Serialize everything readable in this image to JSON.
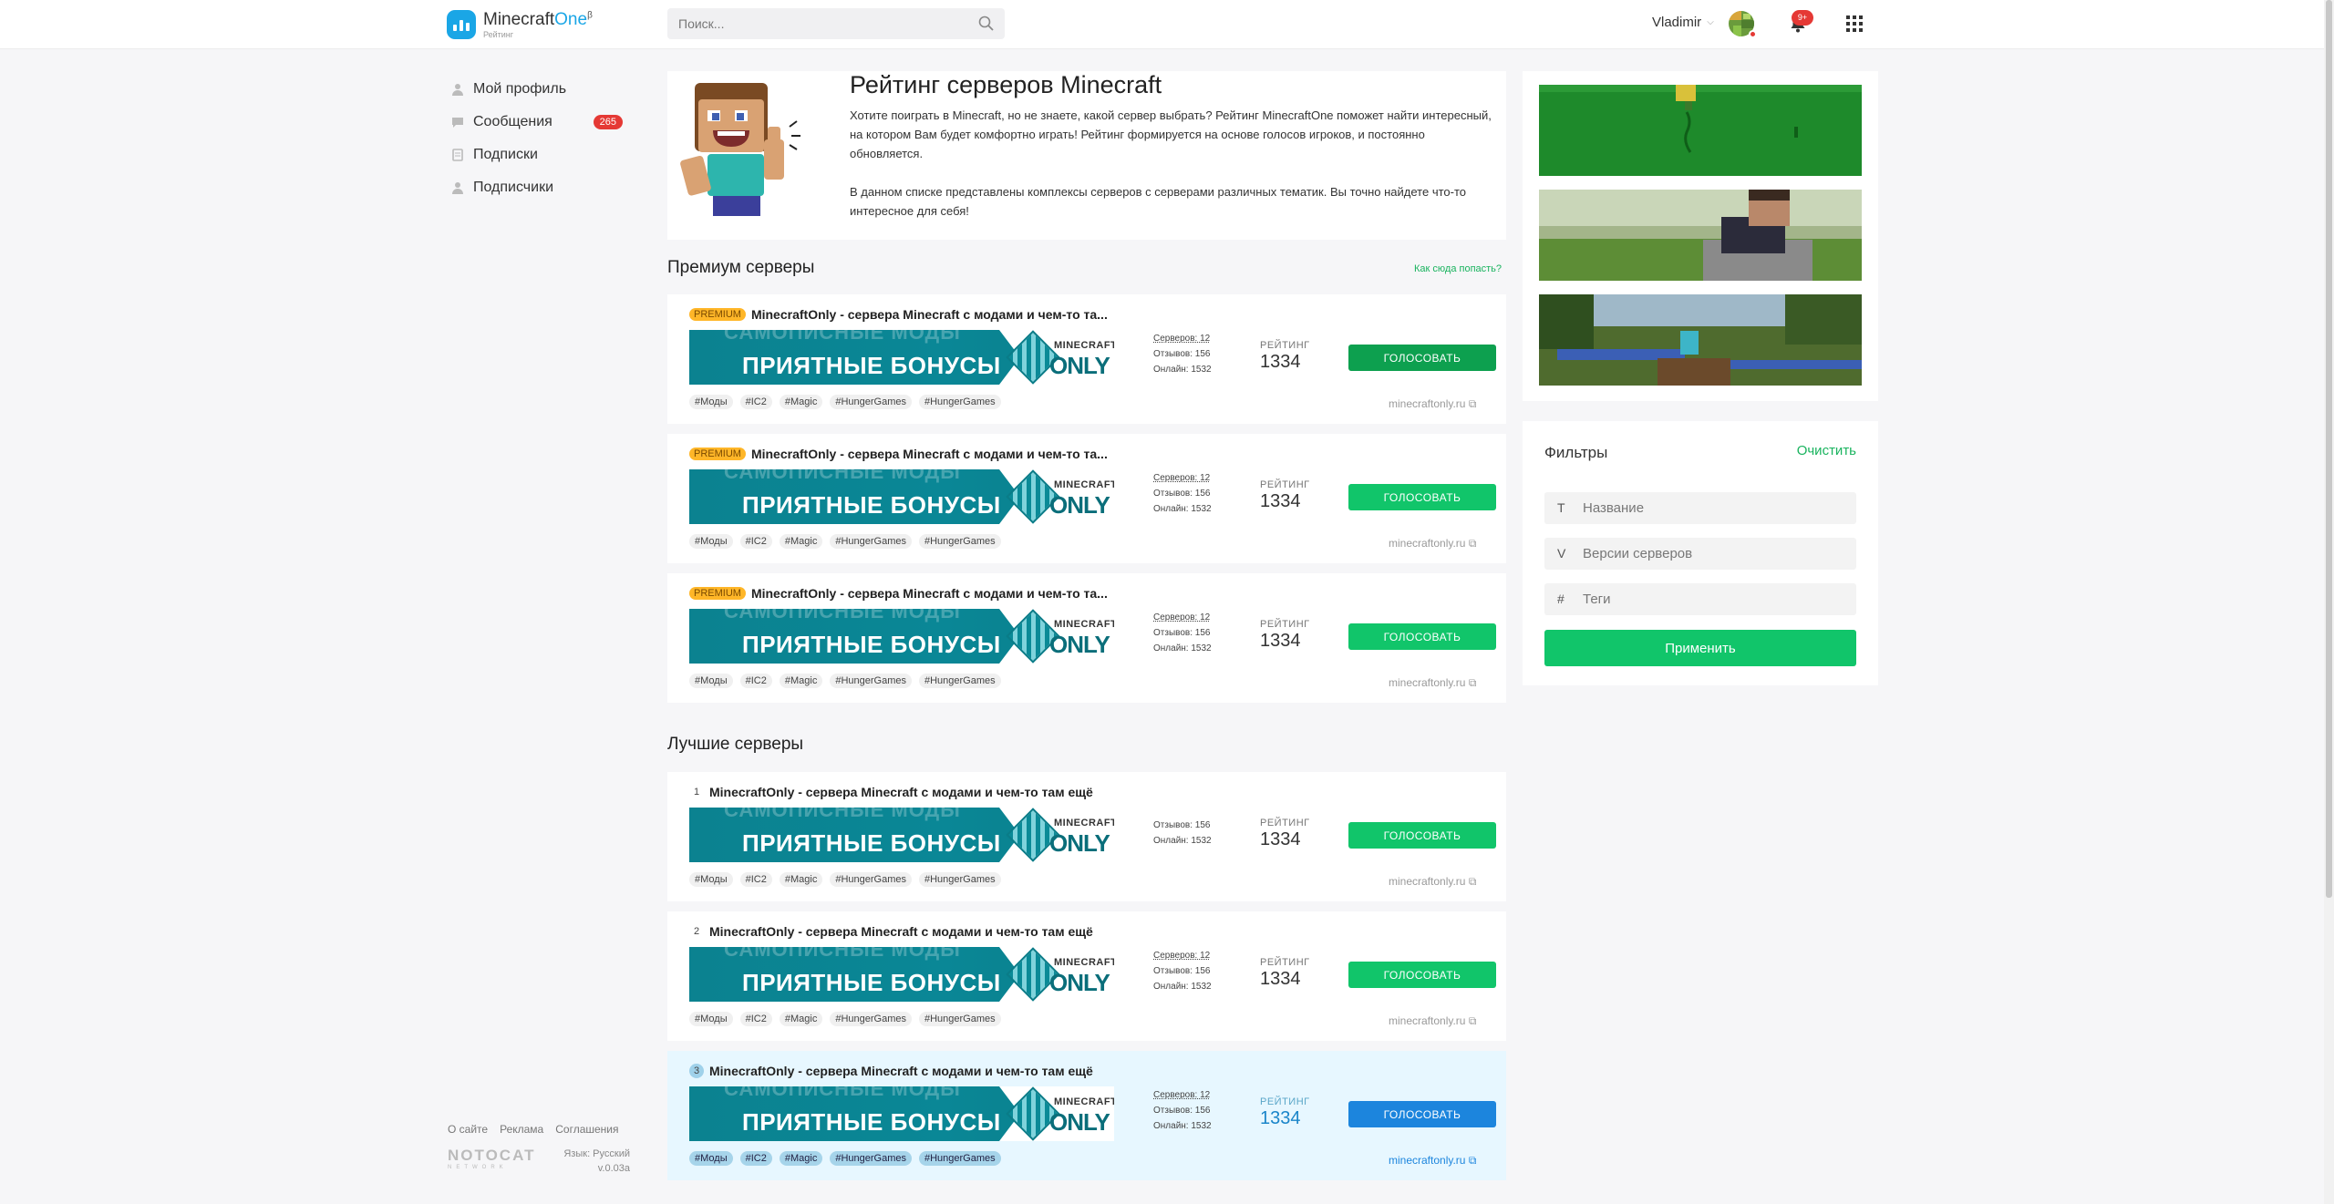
{
  "header": {
    "logo_name": "Minecraft",
    "logo_accent": "One",
    "logo_beta": "β",
    "logo_sub": "Рейтинг",
    "search_placeholder": "Поиск...",
    "username": "Vladimir",
    "notifications_badge": "9+"
  },
  "sidebar": {
    "items": [
      {
        "label": "Мой профиль",
        "icon": "user-icon"
      },
      {
        "label": "Сообщения",
        "icon": "chat-icon",
        "badge": "265"
      },
      {
        "label": "Подписки",
        "icon": "bookmark-icon"
      },
      {
        "label": "Подписчики",
        "icon": "followers-icon"
      }
    ],
    "footer": {
      "links": [
        "О сайте",
        "Реклама",
        "Соглашения"
      ],
      "brand": "NOTOCAT",
      "brand_sub": "NETWORK",
      "language": "Язык: Русский",
      "version": "v.0.03a"
    }
  },
  "hero": {
    "title": "Рейтинг серверов Minecraft",
    "p1": "Хотите поиграть в Minecraft, но не знаете, какой сервер выбрать? Рейтинг MinecraftOne поможет найти интересный, на котором Вам будет комфортно играть! Рейтинг формируется на основе голосов игроков, и постоянно обновляется.",
    "p2": "В данном списке представлены комплексы серверов с серверами различных тематик. Вы точно найдете что-то интересное для себя!"
  },
  "premium": {
    "title": "Премиум серверы",
    "how_link": "Как сюда попасть?",
    "cards": [
      {
        "badge": "PREMIUM",
        "name": "MinecraftOnly - сервера Minecraft с модами и чем-то та...",
        "servers": "Серверов: 12",
        "reviews": "Отзывов: 156",
        "online": "Онлайн: 1532",
        "rating_label": "РЕЙТИНГ",
        "rating": "1334",
        "vote": "ГОЛОСОВАТЬ",
        "site": "minecraftonly.ru",
        "tags": [
          "#Моды",
          "#IC2",
          "#Magic",
          "#HungerGames",
          "#HungerGames"
        ]
      },
      {
        "badge": "PREMIUM",
        "name": "MinecraftOnly - сервера Minecraft с модами и чем-то та...",
        "servers": "Серверов: 12",
        "reviews": "Отзывов: 156",
        "online": "Онлайн: 1532",
        "rating_label": "РЕЙТИНГ",
        "rating": "1334",
        "vote": "ГОЛОСОВАТЬ",
        "site": "minecraftonly.ru",
        "tags": [
          "#Моды",
          "#IC2",
          "#Magic",
          "#HungerGames",
          "#HungerGames"
        ]
      },
      {
        "badge": "PREMIUM",
        "name": "MinecraftOnly - сервера Minecraft с модами и чем-то та...",
        "servers": "Серверов: 12",
        "reviews": "Отзывов: 156",
        "online": "Онлайн: 1532",
        "rating_label": "РЕЙТИНГ",
        "rating": "1334",
        "vote": "ГОЛОСОВАТЬ",
        "site": "minecraftonly.ru",
        "tags": [
          "#Моды",
          "#IC2",
          "#Magic",
          "#HungerGames",
          "#HungerGames"
        ]
      }
    ]
  },
  "best": {
    "title": "Лучшие серверы",
    "cards": [
      {
        "rank": "1",
        "name": "MinecraftOnly - сервера Minecraft с модами и чем-то там ещё",
        "reviews": "Отзывов: 156",
        "online": "Онлайн: 1532",
        "rating_label": "РЕЙТИНГ",
        "rating": "1334",
        "vote": "ГОЛОСОВАТЬ",
        "site": "minecraftonly.ru",
        "tags": [
          "#Моды",
          "#IC2",
          "#Magic",
          "#HungerGames",
          "#HungerGames"
        ]
      },
      {
        "rank": "2",
        "name": "MinecraftOnly - сервера Minecraft с модами и чем-то там ещё",
        "servers": "Серверов: 12",
        "reviews": "Отзывов: 156",
        "online": "Онлайн: 1532",
        "rating_label": "РЕЙТИНГ",
        "rating": "1334",
        "vote": "ГОЛОСОВАТЬ",
        "site": "minecraftonly.ru",
        "tags": [
          "#Моды",
          "#IC2",
          "#Magic",
          "#HungerGames",
          "#HungerGames"
        ]
      },
      {
        "rank": "3",
        "name": "MinecraftOnly - сервера Minecraft с модами и чем-то там ещё",
        "servers": "Серверов: 12",
        "reviews": "Отзывов: 156",
        "online": "Онлайн: 1532",
        "rating_label": "РЕЙТИНГ",
        "rating": "1334",
        "vote": "ГОЛОСОВАТЬ",
        "site": "minecraftonly.ru",
        "tags": [
          "#Моды",
          "#IC2",
          "#Magic",
          "#HungerGames",
          "#HungerGames"
        ]
      }
    ]
  },
  "banner": {
    "top_text": "САМОПИСНЫЕ МОДЫ",
    "main_text": "ПРИЯТНЫЕ БОНУСЫ",
    "logo_top": "MINECRAFT",
    "logo_bottom": "ONLY"
  },
  "filters": {
    "title": "Фильтры",
    "clear": "Очистить",
    "fields": [
      {
        "prefix": "T",
        "placeholder": "Название"
      },
      {
        "prefix": "V",
        "placeholder": "Версии серверов"
      },
      {
        "prefix": "#",
        "placeholder": "Теги"
      }
    ],
    "apply": "Применить"
  },
  "colors": {
    "accent": "#11c56a",
    "brand": "#1aa6e6",
    "highlight_button": "#1c85dd",
    "badge": "#e53935"
  }
}
